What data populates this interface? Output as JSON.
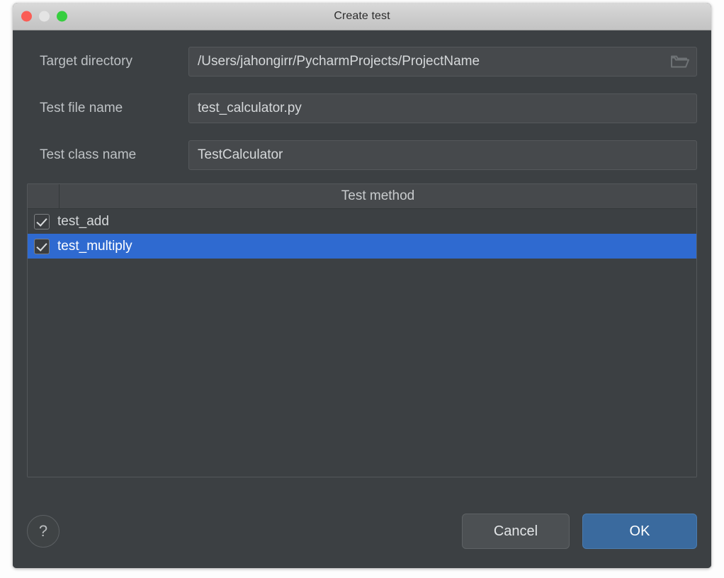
{
  "window": {
    "title": "Create test",
    "traffic_lights": [
      {
        "name": "close",
        "color": "#fa5d55"
      },
      {
        "name": "minimize",
        "color": "#e4e4e4"
      },
      {
        "name": "zoom",
        "color": "#36ce3f"
      }
    ]
  },
  "form": {
    "rows": [
      {
        "label": "Target directory",
        "value": "/Users/jahongirr/PycharmProjects/ProjectName",
        "placeholder": "",
        "has_browse": true,
        "browse_icon": "folder-icon"
      },
      {
        "label": "Test file name",
        "value": "test_calculator.py",
        "placeholder": "",
        "has_browse": false
      },
      {
        "label": "Test class name",
        "value": "TestCalculator",
        "placeholder": "",
        "has_browse": false
      }
    ]
  },
  "table": {
    "header": {
      "checkbox_column": "",
      "method_column": "Test method"
    },
    "rows": [
      {
        "checked": true,
        "name": "test_add",
        "selected": false
      },
      {
        "checked": true,
        "name": "test_multiply",
        "selected": true
      }
    ]
  },
  "footer": {
    "help_label": "?",
    "cancel_label": "Cancel",
    "ok_label": "OK"
  },
  "colors": {
    "dialog_background": "#3c4043",
    "field_background": "#46494c",
    "titlebar_background": "#cccccc",
    "selection_blue": "#2f6ad0",
    "ok_button_blue": "#3a6a9e",
    "label_text": "#bdc1c4"
  }
}
